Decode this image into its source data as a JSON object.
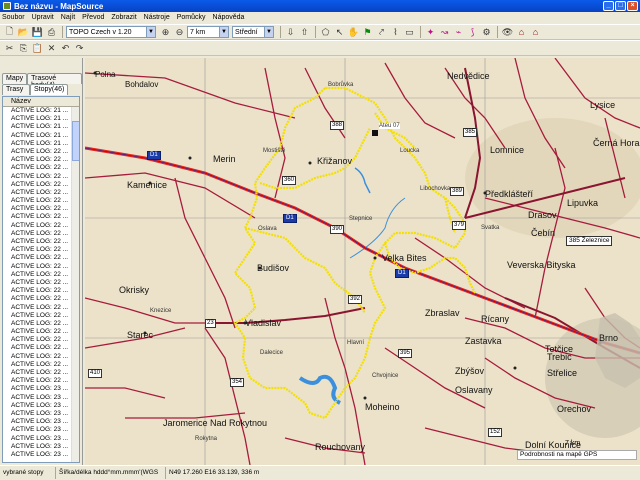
{
  "window": {
    "title": "Bez názvu - MapSource"
  },
  "menu": [
    "Soubor",
    "Upravit",
    "Najít",
    "Převod",
    "Zobrazit",
    "Nástroje",
    "Pomůcky",
    "Nápověda"
  ],
  "toolbar": {
    "map_product": "TOPO Czech v 1.20",
    "zoom_value": "7 km",
    "detail_level": "Střední"
  },
  "left_panel": {
    "tabs_row1": [
      "Mapy",
      "Trasové body(4)"
    ],
    "tabs_row2": [
      "Trasy",
      "Stopy(46)"
    ],
    "list_header": "Název",
    "items": [
      "ACTIVE LOG: 21 ...",
      "ACTIVE LOG: 21 ...",
      "ACTIVE LOG: 21 ...",
      "ACTIVE LOG: 21 ...",
      "ACTIVE LOG: 21 ...",
      "ACTIVE LOG: 22 ...",
      "ACTIVE LOG: 22 ...",
      "ACTIVE LOG: 22 ...",
      "ACTIVE LOG: 22 ...",
      "ACTIVE LOG: 22 ...",
      "ACTIVE LOG: 22 ...",
      "ACTIVE LOG: 22 ...",
      "ACTIVE LOG: 22 ...",
      "ACTIVE LOG: 22 ...",
      "ACTIVE LOG: 22 ...",
      "ACTIVE LOG: 22 ...",
      "ACTIVE LOG: 22 ...",
      "ACTIVE LOG: 22 ...",
      "ACTIVE LOG: 22 ...",
      "ACTIVE LOG: 22 ...",
      "ACTIVE LOG: 22 ...",
      "ACTIVE LOG: 22 ...",
      "ACTIVE LOG: 22 ...",
      "ACTIVE LOG: 22 ...",
      "ACTIVE LOG: 22 ...",
      "ACTIVE LOG: 22 ...",
      "ACTIVE LOG: 22 ...",
      "ACTIVE LOG: 22 ...",
      "ACTIVE LOG: 22 ...",
      "ACTIVE LOG: 22 ...",
      "ACTIVE LOG: 22 ...",
      "ACTIVE LOG: 22 ...",
      "ACTIVE LOG: 22 ...",
      "ACTIVE LOG: 22 ...",
      "ACTIVE LOG: 23 ...",
      "ACTIVE LOG: 23 ...",
      "ACTIVE LOG: 23 ...",
      "ACTIVE LOG: 23 ...",
      "ACTIVE LOG: 23 ...",
      "ACTIVE LOG: 23 ...",
      "ACTIVE LOG: 23 ...",
      "ACTIVE LOG: 23 ...",
      "ACTIVE LOG: 23 ..."
    ]
  },
  "map": {
    "towns_big": [
      "Bobrůvka",
      "Nedvědice",
      "Lysice",
      "Merin",
      "Lomnice",
      "Černá Hora",
      "Kamenice",
      "Křižanov",
      "Předklášteří",
      "Lipuvka",
      "Drasov",
      "Čebín",
      "Velka Bites",
      "Veverska Bityska",
      "Budišov",
      "Okrisky",
      "Zbraslav",
      "Rícany",
      "Vladislav",
      "Zastavka",
      "Starec",
      "Trebic",
      "Tetčice",
      "Střelice",
      "Brno",
      "Zbýšov",
      "Oslavany",
      "Moheino",
      "Orechov",
      "Jaromerice Nad Rokytnou",
      "Dolní Kounice",
      "Rouchovany",
      "Polna",
      "Bohdalov"
    ],
    "towns_small": [
      "Mostiště",
      "Loucka",
      "Libochovka",
      "Stepnice",
      "Oslava",
      "Svatka",
      "Dalecice",
      "Hlavní",
      "Chvojnice",
      "Rokytna",
      "Knezice"
    ],
    "roads": [
      "385",
      "389",
      "379",
      "388",
      "360",
      "390",
      "392",
      "23",
      "395",
      "410",
      "152",
      "354"
    ],
    "highways": [
      "D1",
      "D1",
      "D1"
    ],
    "poi_label": "Ateu 07",
    "popup_label": "385 Železnice",
    "scale_label": "7 km",
    "detail_text": "Podrobnosti na mapě GPS"
  },
  "status": {
    "selected": "vybrané stopy 46",
    "format": "Šířka/délka hddd°mm.mmm'(WGS 84)",
    "coords": "N49 17.260 E16 33.139, 336 m"
  },
  "colors": {
    "track": "#f3e000",
    "highway": "#d01818",
    "road": "#a61c3c",
    "land": "#ede4cf"
  }
}
